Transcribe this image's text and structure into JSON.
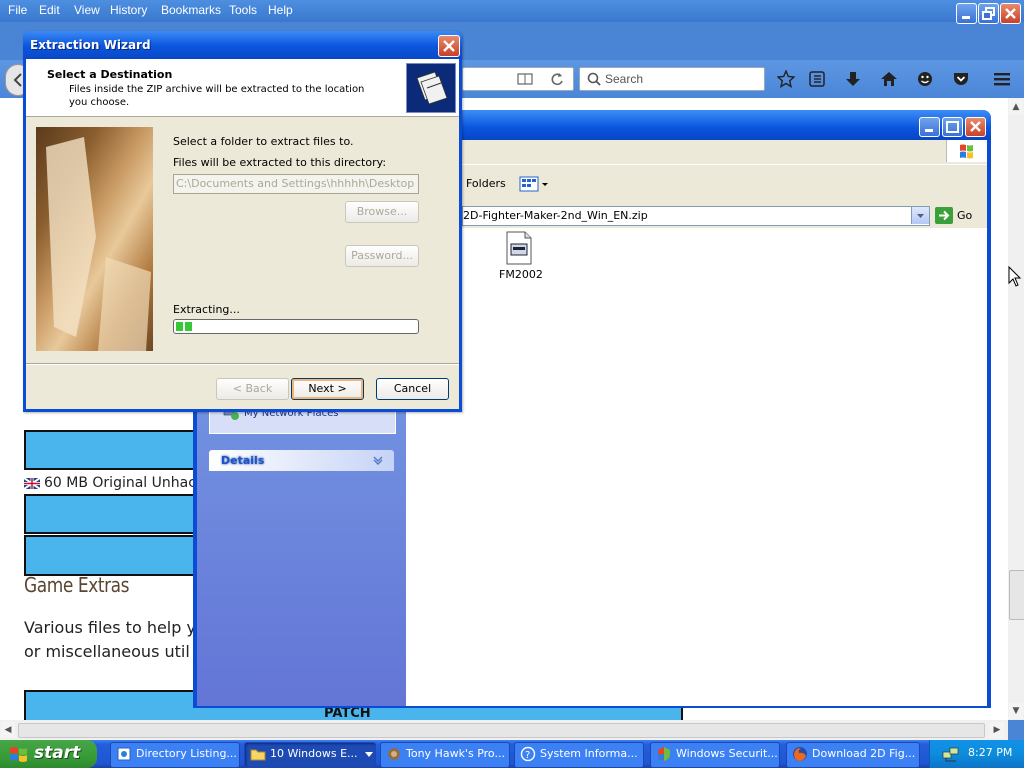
{
  "firefox": {
    "menu": [
      "File",
      "Edit",
      "View",
      "History",
      "Bookmarks",
      "Tools",
      "Help"
    ],
    "search_placeholder": "Search"
  },
  "webpage": {
    "download_text": "60 MB Original Unhac",
    "section_title": "Game Extras",
    "paragraph_line1": "Various files to help y",
    "paragraph_line2": "or miscellaneous util",
    "patch_label": "PATCH"
  },
  "explorer": {
    "folders_label": "Folders",
    "address": "2D-Fighter-Maker-2nd_Win_EN.zip",
    "go_label": "Go",
    "file_name": "FM2002",
    "network_places": "My Network Places",
    "details_label": "Details"
  },
  "wizard": {
    "title": "Extraction Wizard",
    "header_title": "Select a Destination",
    "header_desc": "Files inside the ZIP archive will be extracted to the location you choose.",
    "select_label": "Select a folder to extract files to.",
    "dir_label": "Files will be extracted to this directory:",
    "path_value": "C:\\Documents and Settings\\hhhhh\\Desktop",
    "browse_label": "Browse...",
    "password_label": "Password...",
    "extracting_label": "Extracting...",
    "progress": 0.07,
    "back_label": "< Back",
    "next_label": "Next >",
    "cancel_label": "Cancel"
  },
  "taskbar": {
    "start_label": "start",
    "tasks": [
      "Directory Listing...",
      "10 Windows E...",
      "Tony Hawk's Pro...",
      "System Informa...",
      "Windows Securit...",
      "Download 2D Fig..."
    ],
    "clock": "8:27 PM"
  }
}
